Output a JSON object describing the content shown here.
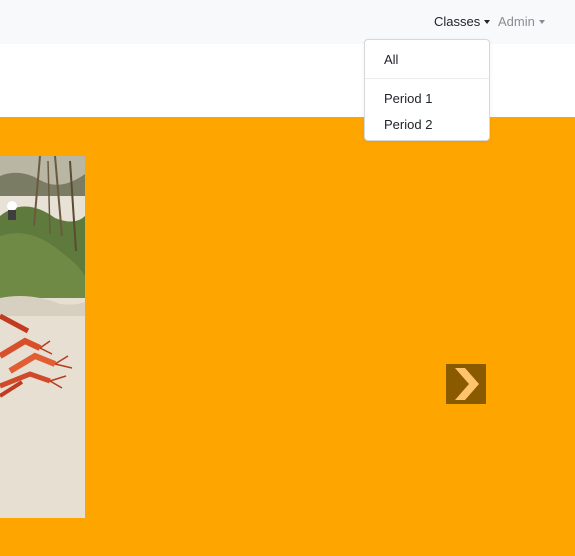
{
  "navbar": {
    "classes_label": "Classes",
    "admin_label": "Admin"
  },
  "classes_menu": {
    "items": [
      "All",
      "Period 1",
      "Period 2"
    ]
  },
  "carousel": {
    "background_color": "#ffa500",
    "control_icon": "chevron-right-icon"
  }
}
